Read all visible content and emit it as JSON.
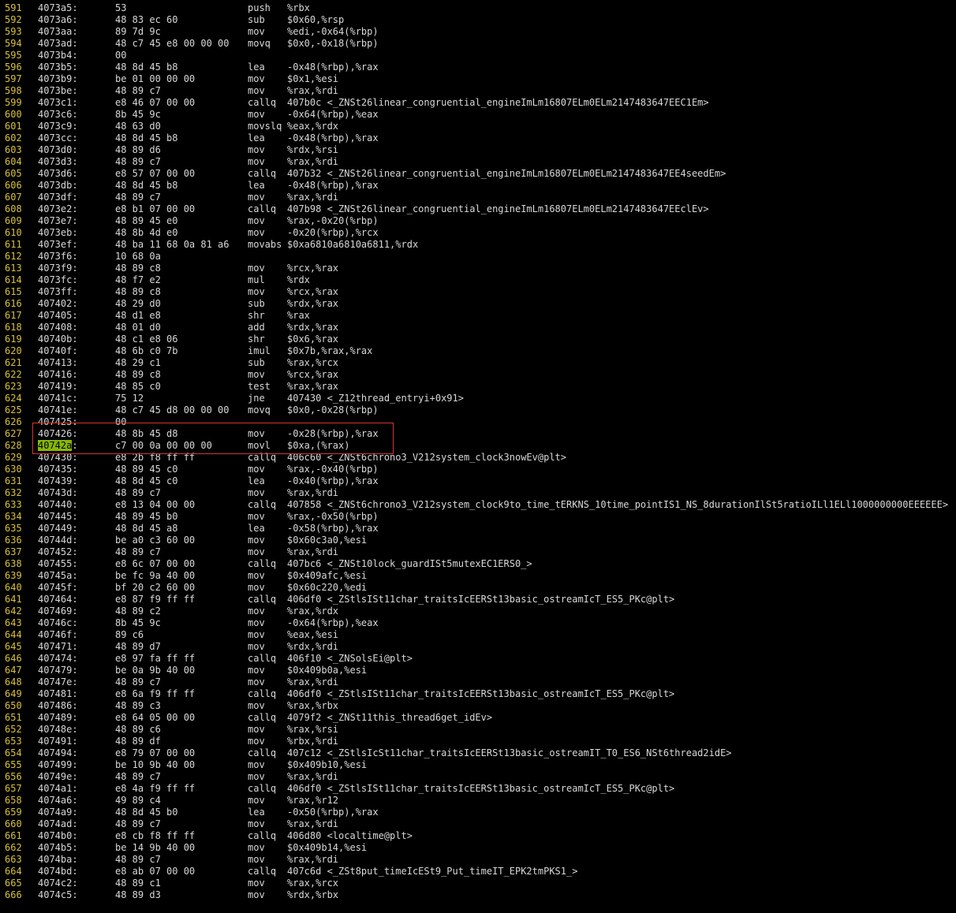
{
  "theme": {
    "background": "#000000",
    "text": "#d8d8d8",
    "line_number": "#d7c23a",
    "highlight": "#86b800",
    "selection_box": "#d33535"
  },
  "listing": [
    {
      "n": "591",
      "addr": "4073a5:",
      "bytes": "53",
      "mn": "push",
      "op": "%rbx"
    },
    {
      "n": "592",
      "addr": "4073a6:",
      "bytes": "48 83 ec 60",
      "mn": "sub",
      "op": "$0x60,%rsp"
    },
    {
      "n": "593",
      "addr": "4073aa:",
      "bytes": "89 7d 9c",
      "mn": "mov",
      "op": "%edi,-0x64(%rbp)"
    },
    {
      "n": "594",
      "addr": "4073ad:",
      "bytes": "48 c7 45 e8 00 00 00",
      "mn": "movq",
      "op": "$0x0,-0x18(%rbp)"
    },
    {
      "n": "595",
      "addr": "4073b4:",
      "bytes": "00",
      "mn": "",
      "op": ""
    },
    {
      "n": "596",
      "addr": "4073b5:",
      "bytes": "48 8d 45 b8",
      "mn": "lea",
      "op": "-0x48(%rbp),%rax"
    },
    {
      "n": "597",
      "addr": "4073b9:",
      "bytes": "be 01 00 00 00",
      "mn": "mov",
      "op": "$0x1,%esi"
    },
    {
      "n": "598",
      "addr": "4073be:",
      "bytes": "48 89 c7",
      "mn": "mov",
      "op": "%rax,%rdi"
    },
    {
      "n": "599",
      "addr": "4073c1:",
      "bytes": "e8 46 07 00 00",
      "mn": "callq",
      "op": "407b0c <_ZNSt26linear_congruential_engineImLm16807ELm0ELm2147483647EEC1Em>"
    },
    {
      "n": "600",
      "addr": "4073c6:",
      "bytes": "8b 45 9c",
      "mn": "mov",
      "op": "-0x64(%rbp),%eax"
    },
    {
      "n": "601",
      "addr": "4073c9:",
      "bytes": "48 63 d0",
      "mn": "movslq",
      "op": "%eax,%rdx"
    },
    {
      "n": "602",
      "addr": "4073cc:",
      "bytes": "48 8d 45 b8",
      "mn": "lea",
      "op": "-0x48(%rbp),%rax"
    },
    {
      "n": "603",
      "addr": "4073d0:",
      "bytes": "48 89 d6",
      "mn": "mov",
      "op": "%rdx,%rsi"
    },
    {
      "n": "604",
      "addr": "4073d3:",
      "bytes": "48 89 c7",
      "mn": "mov",
      "op": "%rax,%rdi"
    },
    {
      "n": "605",
      "addr": "4073d6:",
      "bytes": "e8 57 07 00 00",
      "mn": "callq",
      "op": "407b32 <_ZNSt26linear_congruential_engineImLm16807ELm0ELm2147483647EE4seedEm>"
    },
    {
      "n": "606",
      "addr": "4073db:",
      "bytes": "48 8d 45 b8",
      "mn": "lea",
      "op": "-0x48(%rbp),%rax"
    },
    {
      "n": "607",
      "addr": "4073df:",
      "bytes": "48 89 c7",
      "mn": "mov",
      "op": "%rax,%rdi"
    },
    {
      "n": "608",
      "addr": "4073e2:",
      "bytes": "e8 b1 07 00 00",
      "mn": "callq",
      "op": "407b98 <_ZNSt26linear_congruential_engineImLm16807ELm0ELm2147483647EEclEv>"
    },
    {
      "n": "609",
      "addr": "4073e7:",
      "bytes": "48 89 45 e0",
      "mn": "mov",
      "op": "%rax,-0x20(%rbp)"
    },
    {
      "n": "610",
      "addr": "4073eb:",
      "bytes": "48 8b 4d e0",
      "mn": "mov",
      "op": "-0x20(%rbp),%rcx"
    },
    {
      "n": "611",
      "addr": "4073ef:",
      "bytes": "48 ba 11 68 0a 81 a6",
      "mn": "movabs",
      "op": "$0xa6810a6810a6811,%rdx"
    },
    {
      "n": "612",
      "addr": "4073f6:",
      "bytes": "10 68 0a",
      "mn": "",
      "op": ""
    },
    {
      "n": "613",
      "addr": "4073f9:",
      "bytes": "48 89 c8",
      "mn": "mov",
      "op": "%rcx,%rax"
    },
    {
      "n": "614",
      "addr": "4073fc:",
      "bytes": "48 f7 e2",
      "mn": "mul",
      "op": "%rdx"
    },
    {
      "n": "615",
      "addr": "4073ff:",
      "bytes": "48 89 c8",
      "mn": "mov",
      "op": "%rcx,%rax"
    },
    {
      "n": "616",
      "addr": "407402:",
      "bytes": "48 29 d0",
      "mn": "sub",
      "op": "%rdx,%rax"
    },
    {
      "n": "617",
      "addr": "407405:",
      "bytes": "48 d1 e8",
      "mn": "shr",
      "op": "%rax"
    },
    {
      "n": "618",
      "addr": "407408:",
      "bytes": "48 01 d0",
      "mn": "add",
      "op": "%rdx,%rax"
    },
    {
      "n": "619",
      "addr": "40740b:",
      "bytes": "48 c1 e8 06",
      "mn": "shr",
      "op": "$0x6,%rax"
    },
    {
      "n": "620",
      "addr": "40740f:",
      "bytes": "48 6b c0 7b",
      "mn": "imul",
      "op": "$0x7b,%rax,%rax"
    },
    {
      "n": "621",
      "addr": "407413:",
      "bytes": "48 29 c1",
      "mn": "sub",
      "op": "%rax,%rcx"
    },
    {
      "n": "622",
      "addr": "407416:",
      "bytes": "48 89 c8",
      "mn": "mov",
      "op": "%rcx,%rax"
    },
    {
      "n": "623",
      "addr": "407419:",
      "bytes": "48 85 c0",
      "mn": "test",
      "op": "%rax,%rax"
    },
    {
      "n": "624",
      "addr": "40741c:",
      "bytes": "75 12",
      "mn": "jne",
      "op": "407430 <_Z12thread_entryi+0x91>"
    },
    {
      "n": "625",
      "addr": "40741e:",
      "bytes": "48 c7 45 d8 00 00 00",
      "mn": "movq",
      "op": "$0x0,-0x28(%rbp)"
    },
    {
      "n": "626",
      "addr": "407425:",
      "bytes": "00",
      "mn": "",
      "op": ""
    },
    {
      "n": "627",
      "addr": "407426:",
      "bytes": "48 8b 45 d8",
      "mn": "mov",
      "op": "-0x28(%rbp),%rax"
    },
    {
      "n": "628",
      "addr": "40742a:",
      "addr_hl": "40742a",
      "addr_rest": ":",
      "bytes": "c7 00 0a 00 00 00",
      "mn": "movl",
      "op": "$0xa,(%rax)"
    },
    {
      "n": "629",
      "addr": "407430:",
      "bytes": "e8 2b f8 ff ff",
      "mn": "callq",
      "op": "406c60 <_ZNSt6chrono3_V212system_clock3nowEv@plt>"
    },
    {
      "n": "630",
      "addr": "407435:",
      "bytes": "48 89 45 c0",
      "mn": "mov",
      "op": "%rax,-0x40(%rbp)"
    },
    {
      "n": "631",
      "addr": "407439:",
      "bytes": "48 8d 45 c0",
      "mn": "lea",
      "op": "-0x40(%rbp),%rax"
    },
    {
      "n": "632",
      "addr": "40743d:",
      "bytes": "48 89 c7",
      "mn": "mov",
      "op": "%rax,%rdi"
    },
    {
      "n": "633",
      "addr": "407440:",
      "bytes": "e8 13 04 00 00",
      "mn": "callq",
      "op": "407858 <_ZNSt6chrono3_V212system_clock9to_time_tERKNS_10time_pointIS1_NS_8durationIlSt5ratioILl1ELl1000000000EEEEEE>"
    },
    {
      "n": "634",
      "addr": "407445:",
      "bytes": "48 89 45 b0",
      "mn": "mov",
      "op": "%rax,-0x50(%rbp)"
    },
    {
      "n": "635",
      "addr": "407449:",
      "bytes": "48 8d 45 a8",
      "mn": "lea",
      "op": "-0x58(%rbp),%rax"
    },
    {
      "n": "636",
      "addr": "40744d:",
      "bytes": "be a0 c3 60 00",
      "mn": "mov",
      "op": "$0x60c3a0,%esi"
    },
    {
      "n": "637",
      "addr": "407452:",
      "bytes": "48 89 c7",
      "mn": "mov",
      "op": "%rax,%rdi"
    },
    {
      "n": "638",
      "addr": "407455:",
      "bytes": "e8 6c 07 00 00",
      "mn": "callq",
      "op": "407bc6 <_ZNSt10lock_guardISt5mutexEC1ERS0_>"
    },
    {
      "n": "639",
      "addr": "40745a:",
      "bytes": "be fc 9a 40 00",
      "mn": "mov",
      "op": "$0x409afc,%esi"
    },
    {
      "n": "640",
      "addr": "40745f:",
      "bytes": "bf 20 c2 60 00",
      "mn": "mov",
      "op": "$0x60c220,%edi"
    },
    {
      "n": "641",
      "addr": "407464:",
      "bytes": "e8 87 f9 ff ff",
      "mn": "callq",
      "op": "406df0 <_ZStlsISt11char_traitsIcEERSt13basic_ostreamIcT_ES5_PKc@plt>"
    },
    {
      "n": "642",
      "addr": "407469:",
      "bytes": "48 89 c2",
      "mn": "mov",
      "op": "%rax,%rdx"
    },
    {
      "n": "643",
      "addr": "40746c:",
      "bytes": "8b 45 9c",
      "mn": "mov",
      "op": "-0x64(%rbp),%eax"
    },
    {
      "n": "644",
      "addr": "40746f:",
      "bytes": "89 c6",
      "mn": "mov",
      "op": "%eax,%esi"
    },
    {
      "n": "645",
      "addr": "407471:",
      "bytes": "48 89 d7",
      "mn": "mov",
      "op": "%rdx,%rdi"
    },
    {
      "n": "646",
      "addr": "407474:",
      "bytes": "e8 97 fa ff ff",
      "mn": "callq",
      "op": "406f10 <_ZNSolsEi@plt>"
    },
    {
      "n": "647",
      "addr": "407479:",
      "bytes": "be 0a 9b 40 00",
      "mn": "mov",
      "op": "$0x409b0a,%esi"
    },
    {
      "n": "648",
      "addr": "40747e:",
      "bytes": "48 89 c7",
      "mn": "mov",
      "op": "%rax,%rdi"
    },
    {
      "n": "649",
      "addr": "407481:",
      "bytes": "e8 6a f9 ff ff",
      "mn": "callq",
      "op": "406df0 <_ZStlsISt11char_traitsIcEERSt13basic_ostreamIcT_ES5_PKc@plt>"
    },
    {
      "n": "650",
      "addr": "407486:",
      "bytes": "48 89 c3",
      "mn": "mov",
      "op": "%rax,%rbx"
    },
    {
      "n": "651",
      "addr": "407489:",
      "bytes": "e8 64 05 00 00",
      "mn": "callq",
      "op": "4079f2 <_ZNSt11this_thread6get_idEv>"
    },
    {
      "n": "652",
      "addr": "40748e:",
      "bytes": "48 89 c6",
      "mn": "mov",
      "op": "%rax,%rsi"
    },
    {
      "n": "653",
      "addr": "407491:",
      "bytes": "48 89 df",
      "mn": "mov",
      "op": "%rbx,%rdi"
    },
    {
      "n": "654",
      "addr": "407494:",
      "bytes": "e8 79 07 00 00",
      "mn": "callq",
      "op": "407c12 <_ZStlsIcSt11char_traitsIcEERSt13basic_ostreamIT_T0_ES6_NSt6thread2idE>"
    },
    {
      "n": "655",
      "addr": "407499:",
      "bytes": "be 10 9b 40 00",
      "mn": "mov",
      "op": "$0x409b10,%esi"
    },
    {
      "n": "656",
      "addr": "40749e:",
      "bytes": "48 89 c7",
      "mn": "mov",
      "op": "%rax,%rdi"
    },
    {
      "n": "657",
      "addr": "4074a1:",
      "bytes": "e8 4a f9 ff ff",
      "mn": "callq",
      "op": "406df0 <_ZStlsISt11char_traitsIcEERSt13basic_ostreamIcT_ES5_PKc@plt>"
    },
    {
      "n": "658",
      "addr": "4074a6:",
      "bytes": "49 89 c4",
      "mn": "mov",
      "op": "%rax,%r12"
    },
    {
      "n": "659",
      "addr": "4074a9:",
      "bytes": "48 8d 45 b0",
      "mn": "lea",
      "op": "-0x50(%rbp),%rax"
    },
    {
      "n": "660",
      "addr": "4074ad:",
      "bytes": "48 89 c7",
      "mn": "mov",
      "op": "%rax,%rdi"
    },
    {
      "n": "661",
      "addr": "4074b0:",
      "bytes": "e8 cb f8 ff ff",
      "mn": "callq",
      "op": "406d80 <localtime@plt>"
    },
    {
      "n": "662",
      "addr": "4074b5:",
      "bytes": "be 14 9b 40 00",
      "mn": "mov",
      "op": "$0x409b14,%esi"
    },
    {
      "n": "663",
      "addr": "4074ba:",
      "bytes": "48 89 c7",
      "mn": "mov",
      "op": "%rax,%rdi"
    },
    {
      "n": "664",
      "addr": "4074bd:",
      "bytes": "e8 ab 07 00 00",
      "mn": "callq",
      "op": "407c6d <_ZSt8put_timeIcESt9_Put_timeIT_EPK2tmPKS1_>"
    },
    {
      "n": "665",
      "addr": "4074c2:",
      "bytes": "48 89 c1",
      "mn": "mov",
      "op": "%rax,%rcx"
    },
    {
      "n": "666",
      "addr": "4074c5:",
      "bytes": "48 89 d3",
      "mn": "mov",
      "op": "%rdx,%rbx"
    }
  ]
}
